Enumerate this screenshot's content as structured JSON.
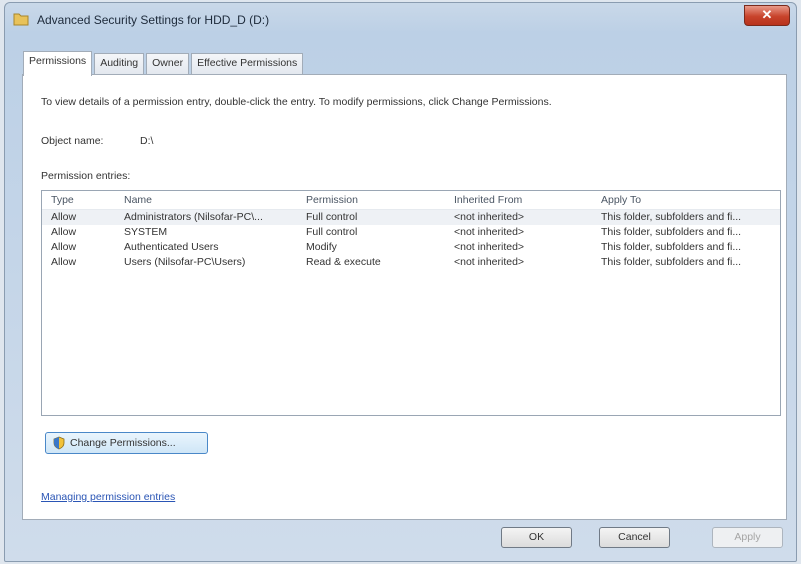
{
  "window": {
    "title": "Advanced Security Settings for HDD_D (D:)",
    "close_label": "✕"
  },
  "tabs": [
    {
      "label": "Permissions",
      "active": true
    },
    {
      "label": "Auditing",
      "active": false
    },
    {
      "label": "Owner",
      "active": false
    },
    {
      "label": "Effective Permissions",
      "active": false
    }
  ],
  "instructions": "To view details of a permission entry, double-click the entry. To modify permissions, click Change Permissions.",
  "object": {
    "label": "Object name:",
    "value": "D:\\"
  },
  "entries_label": "Permission entries:",
  "table": {
    "columns": [
      "Type",
      "Name",
      "Permission",
      "Inherited From",
      "Apply To"
    ],
    "rows": [
      [
        "Allow",
        "Administrators (Nilsofar-PC\\...",
        "Full control",
        "<not inherited>",
        "This folder, subfolders and fi..."
      ],
      [
        "Allow",
        "SYSTEM",
        "Full control",
        "<not inherited>",
        "This folder, subfolders and fi..."
      ],
      [
        "Allow",
        "Authenticated Users",
        "Modify",
        "<not inherited>",
        "This folder, subfolders and fi..."
      ],
      [
        "Allow",
        "Users (Nilsofar-PC\\Users)",
        "Read & execute",
        "<not inherited>",
        "This folder, subfolders and fi..."
      ]
    ]
  },
  "change_permissions_label": "Change Permissions...",
  "manage_link": "Managing permission entries",
  "buttons": {
    "ok": "OK",
    "cancel": "Cancel",
    "apply": "Apply"
  },
  "icons": {
    "title": "folder-icon",
    "change": "uac-shield-icon"
  }
}
